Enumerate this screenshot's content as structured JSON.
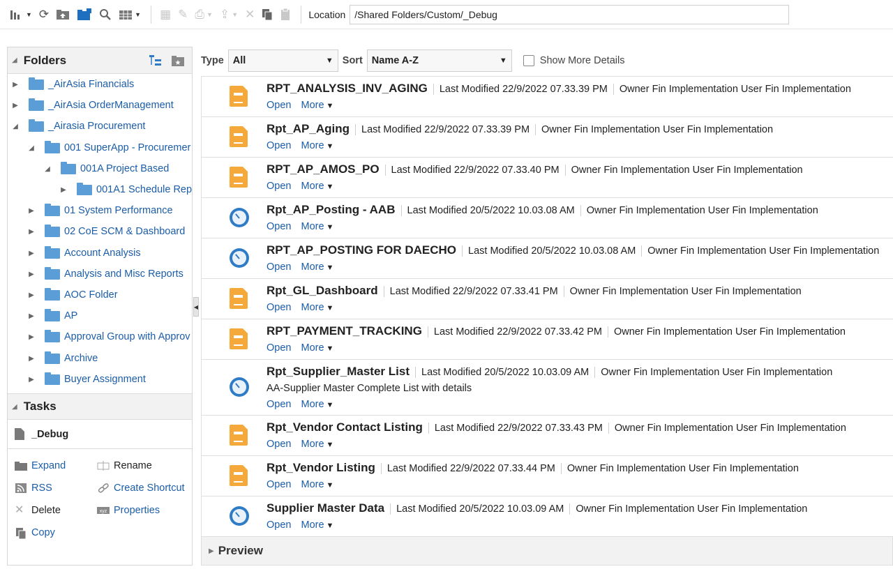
{
  "toolbar": {
    "location_label": "Location",
    "location_value": "/Shared Folders/Custom/_Debug"
  },
  "folders_panel": {
    "title": "Folders",
    "items": [
      {
        "label": "_AirAsia Financials",
        "level": 0,
        "expanded": false
      },
      {
        "label": "_AirAsia OrderManagement",
        "level": 0,
        "expanded": false
      },
      {
        "label": "_Airasia Procurement",
        "level": 0,
        "expanded": true
      },
      {
        "label": "001 SuperApp - Procuremer",
        "level": 1,
        "expanded": true
      },
      {
        "label": "001A Project Based",
        "level": 2,
        "expanded": true
      },
      {
        "label": "001A1 Schedule Rep",
        "level": 3,
        "expanded": false
      },
      {
        "label": "01 System Performance",
        "level": 1,
        "expanded": false
      },
      {
        "label": "02 CoE SCM & Dashboard",
        "level": 1,
        "expanded": false
      },
      {
        "label": "Account Analysis",
        "level": 1,
        "expanded": false
      },
      {
        "label": "Analysis and Misc Reports",
        "level": 1,
        "expanded": false
      },
      {
        "label": "AOC Folder",
        "level": 1,
        "expanded": false
      },
      {
        "label": "AP",
        "level": 1,
        "expanded": false
      },
      {
        "label": "Approval Group with Approv",
        "level": 1,
        "expanded": false
      },
      {
        "label": "Archive",
        "level": 1,
        "expanded": false
      },
      {
        "label": "Buyer Assignment",
        "level": 1,
        "expanded": false
      }
    ]
  },
  "tasks_panel": {
    "title": "Tasks",
    "selected": "_Debug",
    "actions": [
      "Expand",
      "Rename",
      "RSS",
      "Create Shortcut",
      "Delete",
      "Properties",
      "Copy"
    ]
  },
  "filter": {
    "type_label": "Type",
    "type_value": "All",
    "sort_label": "Sort",
    "sort_value": "Name A-Z",
    "show_more": "Show More Details"
  },
  "items": [
    {
      "name": "RPT_ANALYSIS_INV_AGING",
      "kind": "report",
      "modified": "Last Modified 22/9/2022 07.33.39 PM",
      "owner": "Owner Fin Implementation User Fin Implementation",
      "desc": ""
    },
    {
      "name": "Rpt_AP_Aging",
      "kind": "report",
      "modified": "Last Modified 22/9/2022 07.33.39 PM",
      "owner": "Owner Fin Implementation User Fin Implementation",
      "desc": ""
    },
    {
      "name": "RPT_AP_AMOS_PO",
      "kind": "report",
      "modified": "Last Modified 22/9/2022 07.33.40 PM",
      "owner": "Owner Fin Implementation User Fin Implementation",
      "desc": ""
    },
    {
      "name": "Rpt_AP_Posting - AAB",
      "kind": "analysis",
      "modified": "Last Modified 20/5/2022 10.03.08 AM",
      "owner": "Owner Fin Implementation User Fin Implementation",
      "desc": ""
    },
    {
      "name": "RPT_AP_POSTING FOR DAECHO",
      "kind": "analysis",
      "modified": "Last Modified 20/5/2022 10.03.08 AM",
      "owner": "Owner Fin Implementation User Fin Implementation",
      "desc": ""
    },
    {
      "name": "Rpt_GL_Dashboard",
      "kind": "report",
      "modified": "Last Modified 22/9/2022 07.33.41 PM",
      "owner": "Owner Fin Implementation User Fin Implementation",
      "desc": ""
    },
    {
      "name": "RPT_PAYMENT_TRACKING",
      "kind": "report",
      "modified": "Last Modified 22/9/2022 07.33.42 PM",
      "owner": "Owner Fin Implementation User Fin Implementation",
      "desc": ""
    },
    {
      "name": "Rpt_Supplier_Master List",
      "kind": "analysis",
      "modified": "Last Modified 20/5/2022 10.03.09 AM",
      "owner": "Owner Fin Implementation User Fin Implementation",
      "desc": "AA-Supplier Master Complete List with details"
    },
    {
      "name": "Rpt_Vendor Contact Listing",
      "kind": "report",
      "modified": "Last Modified 22/9/2022 07.33.43 PM",
      "owner": "Owner Fin Implementation User Fin Implementation",
      "desc": ""
    },
    {
      "name": "Rpt_Vendor Listing",
      "kind": "report",
      "modified": "Last Modified 22/9/2022 07.33.44 PM",
      "owner": "Owner Fin Implementation User Fin Implementation",
      "desc": ""
    },
    {
      "name": "Supplier Master Data",
      "kind": "analysis",
      "modified": "Last Modified 20/5/2022 10.03.09 AM",
      "owner": "Owner Fin Implementation User Fin Implementation",
      "desc": ""
    }
  ],
  "item_actions": {
    "open": "Open",
    "more": "More"
  },
  "preview": {
    "title": "Preview"
  }
}
